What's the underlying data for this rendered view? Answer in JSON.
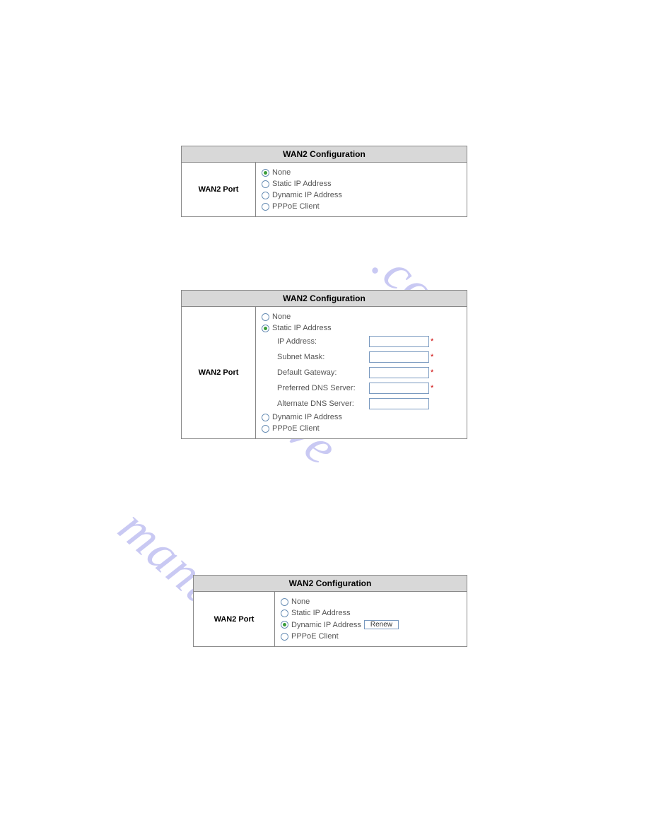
{
  "panel1": {
    "title": "WAN2 Configuration",
    "left_label": "WAN2 Port",
    "options": {
      "none": "None",
      "static": "Static IP Address",
      "dynamic": "Dynamic IP Address",
      "pppoe": "PPPoE Client"
    }
  },
  "panel2": {
    "title": "WAN2 Configuration",
    "left_label": "WAN2 Port",
    "options": {
      "none": "None",
      "static": "Static IP Address",
      "dynamic": "Dynamic IP Address",
      "pppoe": "PPPoE Client"
    },
    "fields": {
      "ip": "IP Address:",
      "subnet": "Subnet Mask:",
      "gateway": "Default Gateway:",
      "dns1": "Preferred DNS Server:",
      "dns2": "Alternate DNS Server:"
    },
    "required_marker": "*"
  },
  "panel3": {
    "title": "WAN2 Configuration",
    "left_label": "WAN2 Port",
    "options": {
      "none": "None",
      "static": "Static IP Address",
      "dynamic": "Dynamic IP Address",
      "pppoe": "PPPoE Client"
    },
    "renew_button": "Renew"
  }
}
